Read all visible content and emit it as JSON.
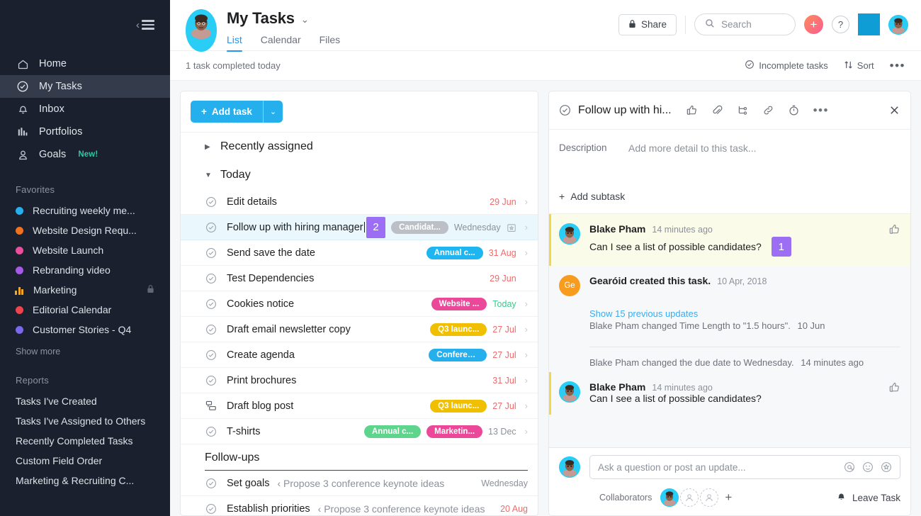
{
  "sidebar": {
    "collapse_label": "Collapse sidebar",
    "nav": [
      {
        "label": "Home",
        "icon": "home-icon",
        "active": false
      },
      {
        "label": "My Tasks",
        "icon": "check-circle-icon",
        "active": true
      },
      {
        "label": "Inbox",
        "icon": "bell-icon",
        "active": false
      },
      {
        "label": "Portfolios",
        "icon": "bar-chart-icon",
        "active": false
      },
      {
        "label": "Goals",
        "icon": "goal-icon",
        "active": false,
        "badge": "New!"
      }
    ],
    "favorites_title": "Favorites",
    "favorites": [
      {
        "label": "Recruiting weekly me...",
        "color": "#25b0ed",
        "style": "dot"
      },
      {
        "label": "Website Design Requ...",
        "color": "#f2711c",
        "style": "dot"
      },
      {
        "label": "Website Launch",
        "color": "#ea4e9d",
        "style": "dot"
      },
      {
        "label": "Rebranding video",
        "color": "#a55ae8",
        "style": "dot"
      },
      {
        "label": "Marketing",
        "color": "#f5a623",
        "style": "bars",
        "locked": true
      },
      {
        "label": "Editorial Calendar",
        "color": "#f0434c",
        "style": "dotted"
      },
      {
        "label": "Customer Stories - Q4",
        "color": "#7b68ee",
        "style": "dot"
      }
    ],
    "show_more": "Show more",
    "reports_title": "Reports",
    "reports": [
      "Tasks I've Created",
      "Tasks I've Assigned to Others",
      "Recently Completed Tasks",
      "Custom Field Order",
      "Marketing & Recruiting C..."
    ]
  },
  "header": {
    "title": "My Tasks",
    "tabs": [
      {
        "label": "List",
        "active": true
      },
      {
        "label": "Calendar",
        "active": false
      },
      {
        "label": "Files",
        "active": false
      }
    ],
    "share_label": "Share",
    "search_placeholder": "Search",
    "plus_label": "+",
    "help_label": "?"
  },
  "subbar": {
    "completed_text": "1 task completed today",
    "incomplete_label": "Incomplete tasks",
    "sort_label": "Sort",
    "more_label": "•••"
  },
  "list": {
    "add_task_label": "Add task",
    "groups": [
      {
        "label": "Recently assigned",
        "expanded": false
      },
      {
        "label": "Today",
        "expanded": true
      }
    ],
    "tasks": [
      {
        "name": "Edit details",
        "icon": "check-circle-icon",
        "pills": [],
        "date": "29 Jun",
        "date_color": "red",
        "chevron": true,
        "selected": false
      },
      {
        "name": "Follow up with hiring manager",
        "icon": "check-circle-icon",
        "count_badge": "2",
        "pills": [
          {
            "label": "Candidat...",
            "color": "#bcc0c6"
          }
        ],
        "date": "Wednesday",
        "date_color": "grey",
        "calendar_badge": true,
        "chevron": true,
        "selected": true,
        "editing": true
      },
      {
        "name": "Send save the date",
        "icon": "check-circle-icon",
        "pills": [
          {
            "label": "Annual c...",
            "color": "#1fb5f0"
          }
        ],
        "date": "31 Aug",
        "date_color": "red",
        "chevron": true,
        "selected": false
      },
      {
        "name": "Test Dependencies",
        "icon": "check-circle-icon",
        "pills": [],
        "date": "29 Jun",
        "date_color": "red",
        "chevron": false,
        "selected": false
      },
      {
        "name": "Cookies notice",
        "icon": "check-circle-icon",
        "pills": [
          {
            "label": "Website ...",
            "color": "#ec4899"
          }
        ],
        "date": "Today",
        "date_color": "green",
        "chevron": true,
        "selected": false
      },
      {
        "name": "Draft email newsletter copy",
        "icon": "check-circle-icon",
        "pills": [
          {
            "label": "Q3 launc...",
            "color": "#f0c000"
          }
        ],
        "date": "27 Jul",
        "date_color": "red",
        "chevron": true,
        "selected": false
      },
      {
        "name": "Create agenda",
        "icon": "check-circle-icon",
        "pills": [
          {
            "label": "Conferen...",
            "color": "#25b0ed"
          }
        ],
        "date": "27 Jul",
        "date_color": "red",
        "chevron": true,
        "selected": false
      },
      {
        "name": "Print brochures",
        "icon": "check-circle-icon",
        "pills": [],
        "date": "31 Jul",
        "date_color": "red",
        "chevron": true,
        "selected": false
      },
      {
        "name": "Draft blog post",
        "icon": "subtask-icon",
        "pills": [
          {
            "label": "Q3 launc...",
            "color": "#f0c000"
          }
        ],
        "date": "27 Jul",
        "date_color": "red",
        "chevron": true,
        "selected": false
      },
      {
        "name": "T-shirts",
        "icon": "check-circle-icon",
        "pills": [
          {
            "label": "Annual c...",
            "color": "#5fd48c"
          },
          {
            "label": "Marketin...",
            "color": "#ec4899"
          }
        ],
        "date": "13 Dec",
        "date_color": "grey",
        "chevron": true,
        "selected": false
      }
    ],
    "followups_title": "Follow-ups",
    "followups": [
      {
        "name": "Set goals",
        "parent": "‹ Propose 3 conference keynote ideas",
        "date": "Wednesday",
        "date_color": "grey"
      },
      {
        "name": "Establish priorities",
        "parent": "‹ Propose 3 conference keynote ideas",
        "date": "20 Aug",
        "date_color": "red"
      }
    ]
  },
  "detail": {
    "title": "Follow up with hi...",
    "icons": [
      "thumbs-up-icon",
      "paperclip-icon",
      "subtask-icon",
      "link-icon",
      "timer-icon",
      "more-icon",
      "close-icon"
    ],
    "description_label": "Description",
    "description_placeholder": "Add more detail to this task...",
    "add_subtask_label": "Add subtask",
    "activity": [
      {
        "type": "comment",
        "author": "Blake Pham",
        "time": "14 minutes ago",
        "text": "Can I see a list of possible candidates?",
        "highlight": true,
        "badge": "1",
        "avatar": "photo"
      },
      {
        "type": "system_created",
        "author": "Gearóid created this task.",
        "time": "10 Apr, 2018",
        "avatar": "initials",
        "initials": "Ge",
        "show_previous": "Show 15 previous updates",
        "previous_line": "Blake Pham changed Time Length to \"1.5 hours\".",
        "previous_time": "10 Jun"
      },
      {
        "type": "system_line",
        "text": "Blake Pham changed the due date to Wednesday.",
        "time": "14 minutes ago"
      },
      {
        "type": "comment",
        "author": "Blake Pham",
        "time": "14 minutes ago",
        "text": "Can I see a list of possible candidates?",
        "highlight": false,
        "avatar": "photo"
      }
    ],
    "comment_placeholder": "Ask a question or post an update...",
    "collaborators_label": "Collaborators",
    "leave_task_label": "Leave Task"
  },
  "colors": {
    "accent_blue": "#25b0ed",
    "sidebar_bg": "#1a202e",
    "highlight_purple": "#9b6ef3",
    "overdue_red": "#f06a6a",
    "today_green": "#3fc78e"
  }
}
